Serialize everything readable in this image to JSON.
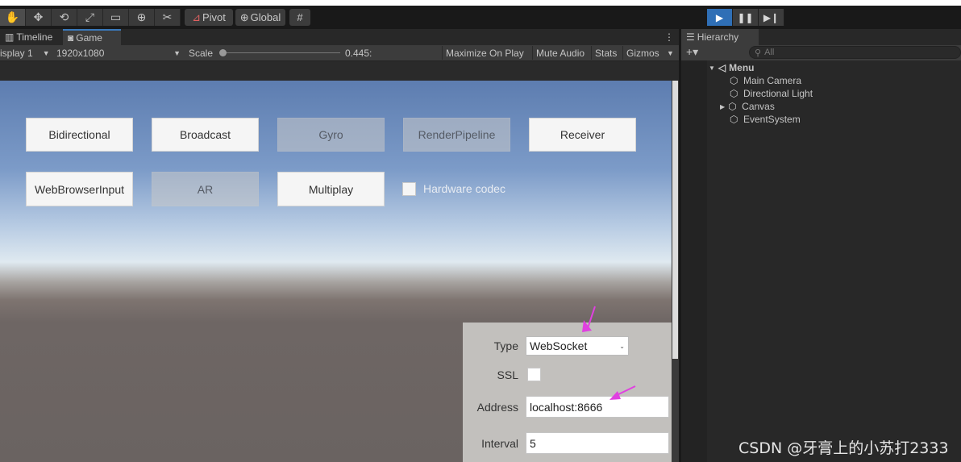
{
  "toolbar": {
    "tools": [
      "hand-tool-icon",
      "move-tool-icon",
      "rotate-tool-icon",
      "scale-tool-icon",
      "rect-tool-icon",
      "transform-tool-icon",
      "custom-tool-icon"
    ],
    "pivot_label": "Pivot",
    "global_label": "Global",
    "play_icons": [
      "play-icon",
      "pause-icon",
      "step-icon"
    ]
  },
  "game_view": {
    "tabs": [
      {
        "label": "Timeline"
      },
      {
        "label": "Game"
      }
    ],
    "display": "isplay 1",
    "resolution": "1920x1080",
    "scale_label": "Scale",
    "scale_value": "0.445:",
    "maximize": "Maximize On Play",
    "mute": "Mute Audio",
    "stats": "Stats",
    "gizmos": "Gizmos",
    "buttons": [
      {
        "label": "Bidirectional",
        "enabled": true
      },
      {
        "label": "Broadcast",
        "enabled": true
      },
      {
        "label": "Gyro",
        "enabled": false
      },
      {
        "label": "RenderPipeline",
        "enabled": false
      },
      {
        "label": "Receiver",
        "enabled": true
      },
      {
        "label": "WebBrowserInput",
        "enabled": true
      },
      {
        "label": "AR",
        "enabled": false
      },
      {
        "label": "Multiplay",
        "enabled": true
      }
    ],
    "hardware_codec_label": "Hardware codec",
    "settings": {
      "type_label": "Type",
      "type_value": "WebSocket",
      "ssl_label": "SSL",
      "address_label": "Address",
      "address_value": "localhost:8666",
      "interval_label": "Interval",
      "interval_value": "5"
    }
  },
  "hierarchy": {
    "tab_label": "Hierarchy",
    "search_placeholder": "All",
    "scene": "Menu",
    "items": [
      "Main Camera",
      "Directional Light",
      "Canvas",
      "EventSystem"
    ]
  },
  "watermark": "CSDN @牙膏上的小苏打2333",
  "colors": {
    "accent": "#3a79bb",
    "play_active": "#2f6fb6",
    "arrow": "#e040e0"
  }
}
